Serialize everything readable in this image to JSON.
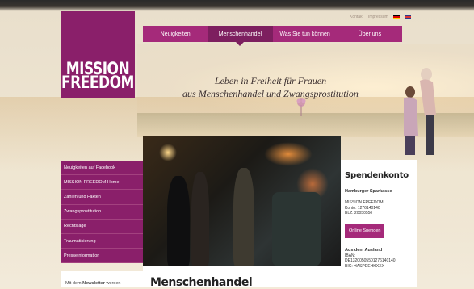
{
  "logo": {
    "line1": "MISSION",
    "line2": "FREEDOM"
  },
  "topbar": {
    "links": [
      "Kontakt",
      "Impressum"
    ],
    "flags": [
      "de-flag-icon",
      "uk-flag-icon"
    ]
  },
  "nav": {
    "items": [
      "Neuigkeiten",
      "Menschenhandel",
      "Was Sie tun können",
      "Über uns"
    ],
    "active_index": 1
  },
  "tagline": {
    "line1": "Leben in Freiheit für Frauen",
    "line2": "aus Menschenhandel und Zwangsprostitution"
  },
  "sidebar": {
    "items": [
      "Neuigkeiten auf Facebook",
      "MISSION FREEDOM Home",
      "Zahlen und Fakten",
      "Zwangsprostitution",
      "Rechtslage",
      "Traumatisierung",
      "Presseinformation"
    ]
  },
  "newsletter": {
    "prefix": "Mit dem ",
    "bold": "Newsletter",
    "suffix": " werden"
  },
  "donate": {
    "title": "Spendenkonto",
    "bank": "Hamburger Sparkasse",
    "lines": [
      "MISSION FREEDOM",
      "Konto: 1276140140",
      "BLZ: 20050550"
    ],
    "button": "Online Spenden",
    "abroad_title": "Aus dem Ausland",
    "iban_lines": [
      "IBAN:",
      "DE13200505501276140140",
      "BIC: HASPDEHHXXX"
    ]
  },
  "content": {
    "title": "Menschenhandel"
  },
  "colors": {
    "brand": "#8a1f6a",
    "nav": "#a52a7a",
    "nav_active": "#7d1f5f"
  }
}
